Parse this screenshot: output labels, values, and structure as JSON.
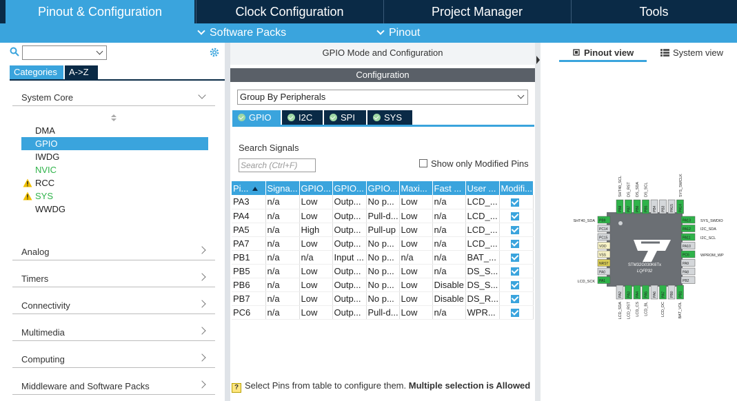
{
  "nav": {
    "tabs": [
      "Pinout & Configuration",
      "Clock Configuration",
      "Project Manager",
      "Tools"
    ],
    "sub": [
      "Software Packs",
      "Pinout"
    ]
  },
  "sidebar": {
    "search_value": "",
    "cat_tabs": [
      "Categories",
      "A->Z"
    ],
    "system_core": {
      "title": "System Core",
      "items": [
        "DMA",
        "GPIO",
        "IWDG",
        "NVIC",
        "RCC",
        "SYS",
        "WWDG"
      ]
    },
    "sections": [
      "Analog",
      "Timers",
      "Connectivity",
      "Multimedia",
      "Computing",
      "Middleware and Software Packs"
    ]
  },
  "middle": {
    "title": "GPIO Mode and Configuration",
    "config_header": "Configuration",
    "group_by": "Group By Peripherals",
    "tabs": [
      "GPIO",
      "I2C",
      "SPI",
      "SYS"
    ],
    "search_label": "Search Signals",
    "search_placeholder": "Search (Ctrl+F)",
    "show_modified": "Show only Modified Pins",
    "columns": [
      "Pi...",
      "Signa...",
      "GPIO...",
      "GPIO...",
      "GPIO...",
      "Maxi...",
      "Fast ...",
      "User ...",
      "Modifi..."
    ],
    "rows": [
      [
        "PA3",
        "n/a",
        "Low",
        "Outp...",
        "No p...",
        "Low",
        "n/a",
        "LCD_..."
      ],
      [
        "PA4",
        "n/a",
        "Low",
        "Outp...",
        "Pull-d...",
        "Low",
        "n/a",
        "LCD_..."
      ],
      [
        "PA5",
        "n/a",
        "High",
        "Outp...",
        "Pull-up",
        "Low",
        "n/a",
        "LCD_..."
      ],
      [
        "PA7",
        "n/a",
        "Low",
        "Outp...",
        "No p...",
        "Low",
        "n/a",
        "LCD_..."
      ],
      [
        "PB1",
        "n/a",
        "n/a",
        "Input ...",
        "No p...",
        "n/a",
        "n/a",
        "BAT_..."
      ],
      [
        "PB5",
        "n/a",
        "Low",
        "Outp...",
        "No p...",
        "Low",
        "n/a",
        "DS_S..."
      ],
      [
        "PB6",
        "n/a",
        "Low",
        "Outp...",
        "No p...",
        "Low",
        "Disable",
        "DS_S..."
      ],
      [
        "PB7",
        "n/a",
        "Low",
        "Outp...",
        "No p...",
        "Low",
        "Disable",
        "DS_R..."
      ],
      [
        "PC6",
        "n/a",
        "Low",
        "Outp...",
        "Pull-d...",
        "Low",
        "n/a",
        "WPR..."
      ]
    ],
    "hint_normal": "Select Pins from table to configure them. ",
    "hint_bold": "Multiple selection is Allowed"
  },
  "right": {
    "tabs": [
      "Pinout view",
      "System view"
    ],
    "chip_name": "STM32G030K6Tx",
    "chip_pkg": "LQFP32",
    "left_labels": [
      "SHT40_SDA",
      "LCD_SCK"
    ],
    "right_labels": [
      "SYS_SWDIO",
      "I2C_SDA",
      "I2C_SCL",
      "WPROM_WP"
    ],
    "top_labels": [
      "SHT40_SCL",
      "DS_RST",
      "DS_SDA",
      "DS_SCL",
      "SYS_SWCLK"
    ],
    "bottom_labels": [
      "LCD_SDA",
      "LCD_RST",
      "LCD_CS",
      "LCD_BL",
      "LCD_DC",
      "BAT_VOL"
    ],
    "left_pins": [
      "PB9",
      "PC14",
      "PC15",
      "VDD",
      "VSS",
      "NRST",
      "PA0",
      "PA1"
    ],
    "right_pins": [
      "PA13",
      "PA12",
      "PA11",
      "PA10",
      "PC6",
      "PA9",
      "PA8",
      "PB2"
    ],
    "top_pins": [
      "PB8",
      "PB7",
      "PB6",
      "PB5",
      "PB4",
      "PB3",
      "PA15",
      "PA14"
    ],
    "bottom_pins": [
      "PA2",
      "PA3",
      "PA4",
      "PA5",
      "PA6",
      "PA7",
      "PB0",
      "PB1"
    ]
  }
}
